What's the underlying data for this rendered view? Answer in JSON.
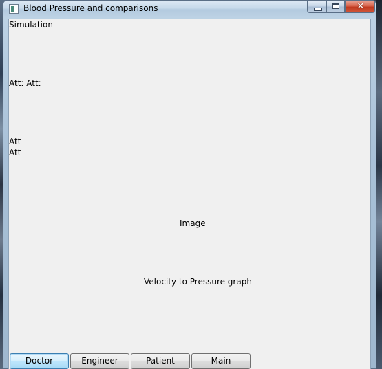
{
  "window": {
    "title": "Blood Pressure and comparisons",
    "close_glyph": "✕"
  },
  "content": {
    "simulation_label": "Simulation",
    "att_row_label": "Att: Att:",
    "att_label_1": "Att",
    "att_label_2": "Att",
    "image_label": "Image",
    "graph_label": "Velocity to Pressure graph"
  },
  "buttons": [
    {
      "label": "Doctor",
      "focused": true
    },
    {
      "label": "Engineer",
      "focused": false
    },
    {
      "label": "Patient",
      "focused": false
    },
    {
      "label": "Main",
      "focused": false
    }
  ],
  "icons": {
    "app": "app-icon",
    "minimize": "minimize-icon",
    "maximize": "maximize-icon",
    "close": "close-icon"
  }
}
